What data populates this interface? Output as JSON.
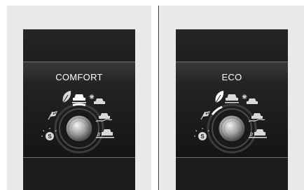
{
  "panels": [
    {
      "mode_title": "COMFORT",
      "selected_mode": "comfort"
    },
    {
      "mode_title": "ECO",
      "selected_mode": "eco"
    }
  ],
  "mode_icons": [
    "sport-icon",
    "eco-leaf-icon",
    "comfort-car-icon",
    "snow-icon",
    "mud-icon",
    "sand-icon",
    "smart-icon"
  ],
  "colors": {
    "screen_background": "#1b1b1b",
    "panel_border": "#6e6e6e",
    "indicator": "#ffffff",
    "icon": "#d9d9d9"
  }
}
